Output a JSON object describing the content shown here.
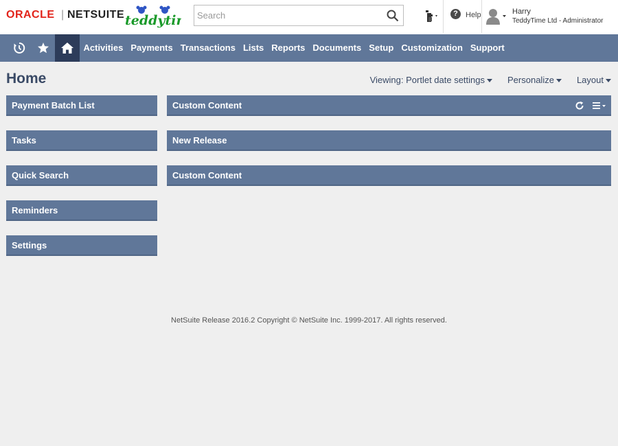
{
  "header": {
    "brand_oracle": "ORACLE",
    "brand_separator": "|",
    "brand_netsuite": "NETSUITE",
    "company_logo_text": "teddytime",
    "search": {
      "placeholder": "Search",
      "value": ""
    },
    "help_label": "Help",
    "user": {
      "name": "Harry",
      "role": "TeddyTime Ltd - Administrator"
    }
  },
  "nav": {
    "items": [
      "Activities",
      "Payments",
      "Transactions",
      "Lists",
      "Reports",
      "Documents",
      "Setup",
      "Customization",
      "Support"
    ]
  },
  "page": {
    "title": "Home",
    "viewing": "Viewing: Portlet date settings",
    "personalize": "Personalize",
    "layout": "Layout"
  },
  "portlets": {
    "left": [
      "Payment Batch List",
      "Tasks",
      "Quick Search",
      "Reminders",
      "Settings"
    ],
    "right": [
      "Custom Content",
      "New Release",
      "Custom Content"
    ]
  },
  "footer": "NetSuite Release 2016.2 Copyright © NetSuite Inc. 1999-2017. All rights reserved.",
  "colors": {
    "nav_bg": "#607799",
    "home_active": "#2d3c5a",
    "portlet_bg": "#607799",
    "oracle_red": "#e2231a"
  },
  "icons": [
    "search-icon",
    "recent-records-icon",
    "help-icon",
    "user-avatar-icon",
    "history-icon",
    "star-icon",
    "home-icon",
    "refresh-icon",
    "menu-icon"
  ]
}
